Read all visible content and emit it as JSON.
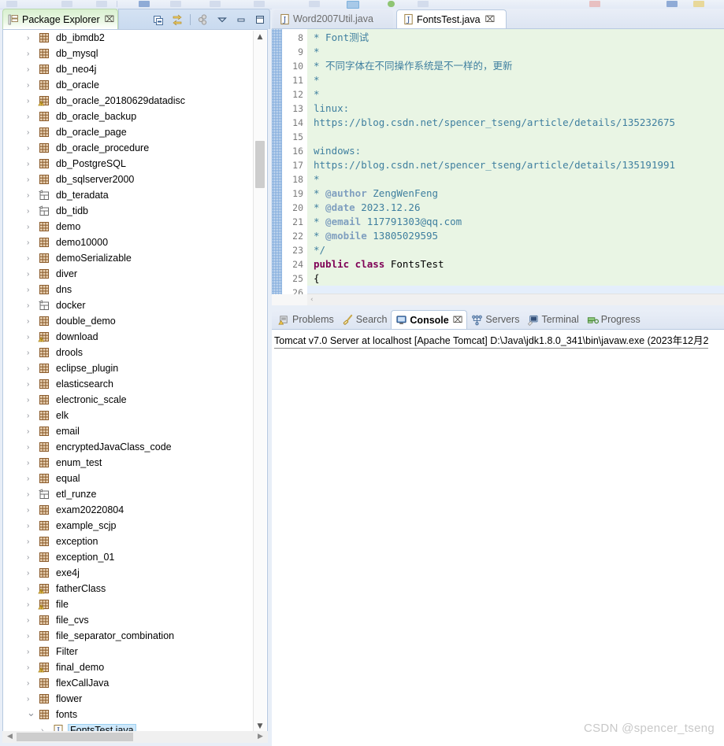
{
  "toolbar": {
    "label": "main-toolbar"
  },
  "package_explorer": {
    "tab_label": "Package Explorer",
    "tab_close": "⌧",
    "tools": [
      {
        "name": "collapse-all-icon",
        "title": "Collapse All"
      },
      {
        "name": "link-with-editor-icon",
        "title": "Link with Editor"
      },
      {
        "name": "view-menu-icon",
        "title": "View Menu"
      },
      {
        "name": "chevron-down-icon",
        "title": "Restore"
      },
      {
        "name": "minimize-icon",
        "title": "Minimize"
      },
      {
        "name": "maximize-icon",
        "title": "Maximize"
      }
    ],
    "items": [
      {
        "label": "db_ibmdb2",
        "icon": "java-project",
        "expanded": false
      },
      {
        "label": "db_mysql",
        "icon": "java-project",
        "expanded": false
      },
      {
        "label": "db_neo4j",
        "icon": "java-project",
        "expanded": false
      },
      {
        "label": "db_oracle",
        "icon": "java-project",
        "expanded": false
      },
      {
        "label": "db_oracle_20180629datadisc",
        "icon": "java-project-warning",
        "expanded": false
      },
      {
        "label": "db_oracle_backup",
        "icon": "java-project",
        "expanded": false
      },
      {
        "label": "db_oracle_page",
        "icon": "java-project",
        "expanded": false
      },
      {
        "label": "db_oracle_procedure",
        "icon": "java-project",
        "expanded": false
      },
      {
        "label": "db_PostgreSQL",
        "icon": "java-project",
        "expanded": false
      },
      {
        "label": "db_sqlserver2000",
        "icon": "java-project",
        "expanded": false
      },
      {
        "label": "db_teradata",
        "icon": "plain-project",
        "expanded": false
      },
      {
        "label": "db_tidb",
        "icon": "plain-project",
        "expanded": false
      },
      {
        "label": "demo",
        "icon": "java-project",
        "expanded": false
      },
      {
        "label": "demo10000",
        "icon": "java-project",
        "expanded": false
      },
      {
        "label": "demoSerializable",
        "icon": "java-project",
        "expanded": false
      },
      {
        "label": "diver",
        "icon": "java-project",
        "expanded": false
      },
      {
        "label": "dns",
        "icon": "java-project",
        "expanded": false
      },
      {
        "label": "docker",
        "icon": "plain-project",
        "expanded": false
      },
      {
        "label": "double_demo",
        "icon": "java-project",
        "expanded": false
      },
      {
        "label": "download",
        "icon": "java-project-warning",
        "expanded": false
      },
      {
        "label": "drools",
        "icon": "java-project",
        "expanded": false
      },
      {
        "label": "eclipse_plugin",
        "icon": "java-project",
        "expanded": false
      },
      {
        "label": "elasticsearch",
        "icon": "java-project",
        "expanded": false
      },
      {
        "label": "electronic_scale",
        "icon": "java-project",
        "expanded": false
      },
      {
        "label": "elk",
        "icon": "java-project",
        "expanded": false
      },
      {
        "label": "email",
        "icon": "java-project",
        "expanded": false
      },
      {
        "label": "encryptedJavaClass_code",
        "icon": "java-project",
        "expanded": false
      },
      {
        "label": "enum_test",
        "icon": "java-project",
        "expanded": false
      },
      {
        "label": "equal",
        "icon": "java-project",
        "expanded": false
      },
      {
        "label": "etl_runze",
        "icon": "plain-project",
        "expanded": false
      },
      {
        "label": "exam20220804",
        "icon": "java-project",
        "expanded": false
      },
      {
        "label": "example_scjp",
        "icon": "java-project",
        "expanded": false
      },
      {
        "label": "exception",
        "icon": "java-project",
        "expanded": false
      },
      {
        "label": "exception_01",
        "icon": "java-project",
        "expanded": false
      },
      {
        "label": "exe4j",
        "icon": "java-project",
        "expanded": false
      },
      {
        "label": "fatherClass",
        "icon": "java-project-warning",
        "expanded": false
      },
      {
        "label": "file",
        "icon": "java-project-warning",
        "expanded": false
      },
      {
        "label": "file_cvs",
        "icon": "java-project",
        "expanded": false
      },
      {
        "label": "file_separator_combination",
        "icon": "java-project",
        "expanded": false
      },
      {
        "label": "Filter",
        "icon": "java-project",
        "expanded": false
      },
      {
        "label": "final_demo",
        "icon": "java-project-warning",
        "expanded": false
      },
      {
        "label": "flexCallJava",
        "icon": "java-project",
        "expanded": false
      },
      {
        "label": "flower",
        "icon": "java-project",
        "expanded": false
      },
      {
        "label": "fonts",
        "icon": "java-project",
        "expanded": true
      },
      {
        "label": "FontsTest.java",
        "icon": "java-file",
        "expanded": false,
        "child": true,
        "selected": true
      }
    ]
  },
  "editor": {
    "tabs": [
      {
        "label": "Word2007Util.java",
        "active": false,
        "icon": "java-file-icon"
      },
      {
        "label": "FontsTest.java",
        "active": true,
        "icon": "java-file-icon",
        "close": "⌧"
      }
    ],
    "scroll_left_arrow": "‹",
    "lines": [
      {
        "num": "8",
        "segs": [
          {
            "t": "*",
            "c": "c-star"
          },
          {
            "t": " Font测试",
            "c": "c-com"
          }
        ]
      },
      {
        "num": "9",
        "segs": [
          {
            "t": "*",
            "c": "c-star"
          }
        ]
      },
      {
        "num": "10",
        "segs": [
          {
            "t": "*",
            "c": "c-star"
          },
          {
            "t": " 不同字体在不同操作系统是不一样的，更新",
            "c": "c-com"
          }
        ]
      },
      {
        "num": "11",
        "segs": [
          {
            "t": "*",
            "c": "c-star"
          }
        ]
      },
      {
        "num": "12",
        "segs": [
          {
            "t": "*",
            "c": "c-star"
          }
        ]
      },
      {
        "num": "13",
        "segs": [
          {
            "t": "linux:",
            "c": "c-com"
          }
        ]
      },
      {
        "num": "14",
        "segs": [
          {
            "t": "https://blog.csdn.net/spencer_tseng/article/details/135232675",
            "c": "c-com"
          }
        ]
      },
      {
        "num": "15",
        "segs": []
      },
      {
        "num": "16",
        "segs": [
          {
            "t": "windows:",
            "c": "c-com"
          }
        ]
      },
      {
        "num": "17",
        "segs": [
          {
            "t": "https://blog.csdn.net/spencer_tseng/article/details/135191991",
            "c": "c-com"
          }
        ]
      },
      {
        "num": "18",
        "segs": [
          {
            "t": "*",
            "c": "c-star"
          }
        ]
      },
      {
        "num": "19",
        "segs": [
          {
            "t": "*",
            "c": "c-star"
          },
          {
            "t": " @author",
            "c": "c-tag"
          },
          {
            "t": " ZengWenFeng",
            "c": "c-com"
          }
        ]
      },
      {
        "num": "20",
        "segs": [
          {
            "t": "*",
            "c": "c-star"
          },
          {
            "t": " @date",
            "c": "c-tag"
          },
          {
            "t": " 2023.12.26",
            "c": "c-com"
          }
        ]
      },
      {
        "num": "21",
        "segs": [
          {
            "t": "*",
            "c": "c-star"
          },
          {
            "t": " @email",
            "c": "c-tag"
          },
          {
            "t": " 117791303@qq.com",
            "c": "c-com"
          }
        ]
      },
      {
        "num": "22",
        "segs": [
          {
            "t": "*",
            "c": "c-star"
          },
          {
            "t": " @mobile",
            "c": "c-tag"
          },
          {
            "t": " 13805029595",
            "c": "c-com"
          }
        ]
      },
      {
        "num": "23",
        "segs": [
          {
            "t": "*/",
            "c": "c-star"
          }
        ]
      },
      {
        "num": "24",
        "segs": [
          {
            "t": "public class",
            "c": "c-kw"
          },
          {
            "t": " FontsTest",
            "c": "c-plain"
          }
        ]
      },
      {
        "num": "25",
        "segs": [
          {
            "t": "{",
            "c": "c-plain"
          }
        ]
      },
      {
        "num": "26",
        "segs": []
      }
    ]
  },
  "console_panel": {
    "tabs": [
      {
        "label": "Problems",
        "icon": "problems-icon",
        "active": false
      },
      {
        "label": "Search",
        "icon": "search-icon",
        "active": false
      },
      {
        "label": "Console",
        "icon": "console-icon",
        "active": true,
        "close": "⌧"
      },
      {
        "label": "Servers",
        "icon": "servers-icon",
        "active": false
      },
      {
        "label": "Terminal",
        "icon": "terminal-icon",
        "active": false
      },
      {
        "label": "Progress",
        "icon": "progress-icon",
        "active": false
      }
    ],
    "output_line": "Tomcat v7.0 Server at localhost [Apache Tomcat] D:\\Java\\jdk1.8.0_341\\bin\\javaw.exe (2023年12月2"
  },
  "watermark": "CSDN @spencer_tseng",
  "colors": {
    "editor_bg": "#e9f5e4",
    "selection": "#cde8fb",
    "tab_active": "#ffffff",
    "chrome": "#dde5f2"
  }
}
